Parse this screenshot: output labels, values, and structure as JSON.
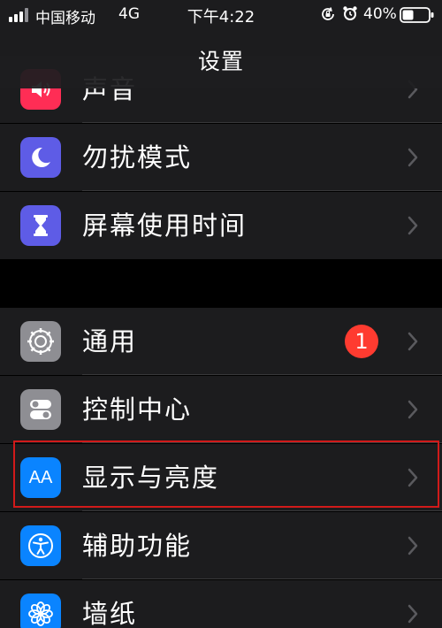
{
  "status_bar": {
    "carrier": "中国移动",
    "network": "4G",
    "time": "下午4:22",
    "battery_percent": "40%"
  },
  "nav": {
    "title": "设置"
  },
  "rows": {
    "sound": {
      "label": "声音",
      "icon": "speaker-icon",
      "color": "#ff2d55"
    },
    "dnd": {
      "label": "勿扰模式",
      "icon": "moon-icon",
      "color": "#5e5ce6"
    },
    "screen_time": {
      "label": "屏幕使用时间",
      "icon": "hourglass-icon",
      "color": "#5e5ce6"
    },
    "general": {
      "label": "通用",
      "icon": "gear-icon",
      "color": "#8e8e93",
      "badge": "1"
    },
    "control_center": {
      "label": "控制中心",
      "icon": "toggles-icon",
      "color": "#8e8e93"
    },
    "display": {
      "label": "显示与亮度",
      "icon": "text-size-icon",
      "color": "#0a84ff",
      "icon_text": "AA"
    },
    "accessibility": {
      "label": "辅助功能",
      "icon": "accessibility-icon",
      "color": "#0a84ff"
    },
    "wallpaper": {
      "label": "墙纸",
      "icon": "flower-icon",
      "color": "#0a84ff"
    }
  },
  "colors": {
    "background": "#000000",
    "row_background": "#1c1c1e",
    "separator": "#38383a",
    "badge": "#ff3b30",
    "highlight": "#d11a1a"
  }
}
